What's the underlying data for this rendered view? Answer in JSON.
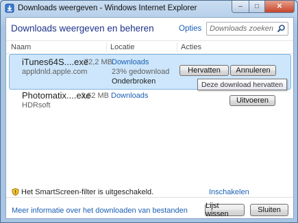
{
  "window": {
    "title": "Downloads weergeven - Windows Internet Explorer",
    "minimize": "–",
    "maximize": "□",
    "close": "✕"
  },
  "header": {
    "title": "Downloads weergeven en beheren",
    "options_link": "Opties",
    "search_placeholder": "Downloads zoeken"
  },
  "columns": {
    "name": "Naam",
    "location": "Locatie",
    "actions": "Acties"
  },
  "downloads": [
    {
      "filename": "iTunes64S....exe",
      "size": "72,2 MB",
      "source": "appldnld.apple.com",
      "location": "Downloads",
      "progress_text": "23% gedownload",
      "progress_pct": 23,
      "status": "Onderbroken",
      "actions": [
        "Hervatten",
        "Annuleren"
      ],
      "tooltip": "Deze download hervatten"
    },
    {
      "filename": "Photomatix....exe",
      "size": "3,62 MB",
      "source": "HDRsoft",
      "location": "Downloads",
      "actions": [
        "Uitvoeren"
      ]
    }
  ],
  "footer": {
    "smartscreen_text": "Het SmartScreen-filter is uitgeschakeld.",
    "enable_link": "Inschakelen",
    "more_info_link": "Meer informatie over het downloaden van bestanden",
    "clear_button": "Lijst wissen",
    "close_button": "Sluiten"
  },
  "colors": {
    "link": "#1a5fb4",
    "title": "#1e3287",
    "selection": "#cde6fb"
  }
}
